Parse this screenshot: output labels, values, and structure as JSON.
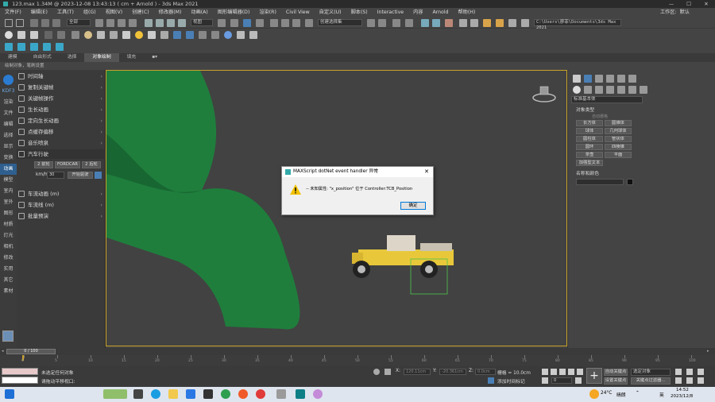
{
  "window": {
    "title": "123.max  1.34M @ 2023-12-08 13:43:13  ( cm + Arnold ) - 3ds Max 2021",
    "minimize": "—",
    "maximize": "☐",
    "close": "✕"
  },
  "menu": {
    "items": [
      "文件(F)",
      "编辑(E)",
      "工具(T)",
      "组(G)",
      "视图(V)",
      "创建(C)",
      "修改器(M)",
      "动画(A)",
      "图形编辑器(D)",
      "渲染(R)",
      "Civil View",
      "自定义(U)",
      "脚本(S)",
      "Interactive",
      "内容",
      "Arnold",
      "帮助(H)"
    ],
    "workspace_label": "工作区:",
    "workspace_value": "默认"
  },
  "toolbar": {
    "filter_dropdown": "全部",
    "view_dropdown": "视图",
    "selection_set": "创建选择集",
    "project_path": "C:\\Users\\廖菲\\Documents\\3ds Max 2021"
  },
  "ribbon": {
    "tabs": [
      "建模",
      "自由形式",
      "选择",
      "对象绘制",
      "填充"
    ],
    "active_tab": "对象绘制",
    "sub_label": "绘制对象，笔刷设置"
  },
  "left_nav": {
    "items": [
      "KDF3",
      "渲染",
      "文件",
      "编辑",
      "选择",
      "显示",
      "变换",
      "动画",
      "模型",
      "室内",
      "室外",
      "图形",
      "材质",
      "灯光",
      "相机",
      "修改",
      "实用",
      "其它",
      "素材"
    ],
    "selected": "动画"
  },
  "anim_panel": {
    "items": [
      {
        "label": "时间轴"
      },
      {
        "label": "复制关键帧"
      },
      {
        "label": "关键帧操作"
      },
      {
        "label": "生长动画"
      },
      {
        "label": "定向生长动画"
      },
      {
        "label": "点缓存偏移"
      },
      {
        "label": "音乐喷泉"
      },
      {
        "label": "汽车行驶"
      }
    ],
    "car_buttons": [
      "2 前轮",
      "FORDCAR",
      "2 后轮"
    ],
    "speed_label": "km/h",
    "speed_value": "30",
    "start_button": "开始驱驶",
    "lower_items": [
      {
        "label": "车流动画 (m)"
      },
      {
        "label": "车流线 (m)"
      },
      {
        "label": "批量预演"
      }
    ]
  },
  "command_panel": {
    "dropdown": "标准基本体",
    "section1_title": "对象类型",
    "autogrid": "自动栅格",
    "buttons": [
      "长方体",
      "圆锥体",
      "球体",
      "几何球体",
      "圆柱体",
      "管状体",
      "圆环",
      "四棱锥",
      "茶壶",
      "平面",
      "加强型文本"
    ],
    "section2_title": "名称和颜色"
  },
  "dialog": {
    "title": "MAXScript dotNet event handler 异常",
    "message": "-- 未知属性: \"x_position\" 位于 Controller:TCB_Position",
    "ok": "确定",
    "close": "✕"
  },
  "timeline": {
    "frame_display": "0 / 100",
    "ticks": [
      "0",
      "5",
      "10",
      "15",
      "20",
      "25",
      "30",
      "35",
      "40",
      "45",
      "50",
      "55",
      "60",
      "65",
      "70",
      "75",
      "80",
      "85",
      "90",
      "95",
      "100"
    ]
  },
  "status": {
    "selection": "未选定任何对象",
    "prompt": "请拖动平移视口:",
    "x_label": "X:",
    "x_value": "120.11cm",
    "y_label": "Y:",
    "y_value": "-20.361cm",
    "z_label": "Z:",
    "z_value": "0.0cm",
    "grid": "栅格 = 10.0cm",
    "add_time_tag": "添加时间标记",
    "autokey": "自动关键点",
    "selected_obj": "选定对象",
    "set_key": "设置关键点",
    "key_filters": "关键点过滤器...",
    "frame": "0"
  },
  "taskbar": {
    "weather_temp": "24°C",
    "weather_text": "晴朗",
    "lang": "英",
    "time": "14:52",
    "date": "2023/12/8"
  },
  "colors": {
    "accent": "#2e5f8f",
    "viewport_border": "#c9a22a",
    "cloth": "#1f7e3c",
    "car_body": "#e8c83a"
  }
}
